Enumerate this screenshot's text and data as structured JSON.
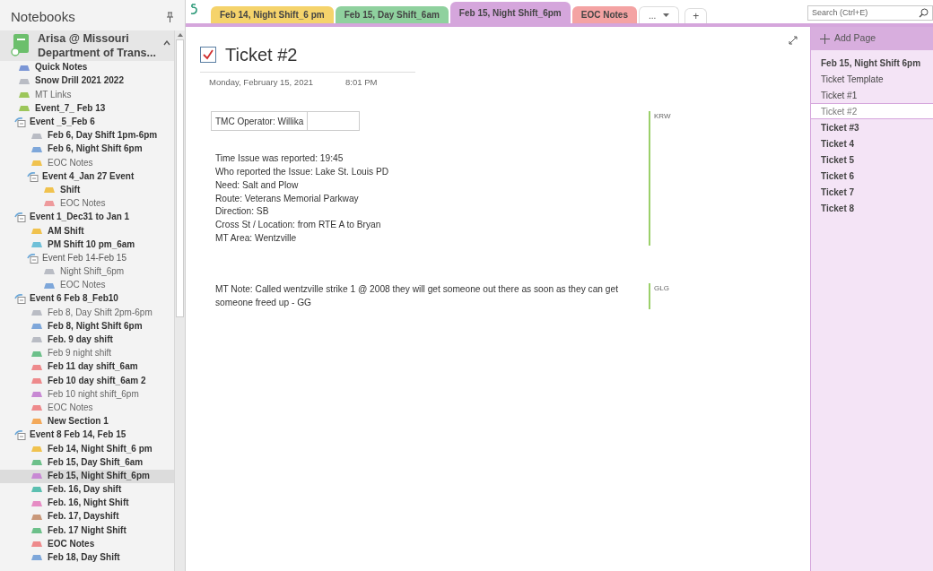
{
  "sidebar": {
    "title": "Notebooks",
    "notebook": {
      "name_line_1": "Arisa @ Missouri",
      "name_line_2": "Department of Trans...",
      "expanded": true
    },
    "items": [
      {
        "kind": "section",
        "label": "Quick Notes",
        "color": "#7b96d6",
        "unread": true,
        "selected": false
      },
      {
        "kind": "section",
        "label": "Snow Drill 2021 2022",
        "color": "#b9bcc4",
        "unread": true,
        "selected": false
      },
      {
        "kind": "section",
        "label": "MT Links",
        "color": "#9cc65a",
        "unread": false,
        "selected": false
      },
      {
        "kind": "section",
        "label": "Event_7_ Feb 13",
        "color": "#9cc65a",
        "unread": true,
        "selected": false
      },
      {
        "kind": "group",
        "label": "Event _5_Feb 6",
        "unread": true,
        "children": [
          {
            "kind": "section",
            "label": "Feb 6, Day Shift 1pm-6pm",
            "color": "#b9bcc4",
            "unread": true,
            "selected": false
          },
          {
            "kind": "section",
            "label": "Feb 6, Night Shift 6pm",
            "color": "#7ea7da",
            "unread": true,
            "selected": false
          },
          {
            "kind": "section",
            "label": "EOC Notes",
            "color": "#f0c24e",
            "unread": false,
            "selected": false
          },
          {
            "kind": "group",
            "label": "Event 4_Jan 27 Event",
            "unread": true,
            "children": [
              {
                "kind": "section",
                "label": "Shift",
                "color": "#f0c24e",
                "unread": true,
                "selected": false
              },
              {
                "kind": "section",
                "label": "EOC Notes",
                "color": "#ee9a9c",
                "unread": false,
                "selected": false
              }
            ]
          }
        ]
      },
      {
        "kind": "group",
        "label": "Event 1_Dec31 to Jan 1",
        "unread": true,
        "children": [
          {
            "kind": "section",
            "label": "AM Shift",
            "color": "#f0c24e",
            "unread": true,
            "selected": false
          },
          {
            "kind": "section",
            "label": "PM Shift 10 pm_6am",
            "color": "#6fc0d8",
            "unread": true,
            "selected": false
          },
          {
            "kind": "group",
            "label": "Event Feb 14-Feb 15",
            "unread": false,
            "children": [
              {
                "kind": "section",
                "label": "Night Shift_6pm",
                "color": "#b9bcc4",
                "unread": false,
                "selected": false
              },
              {
                "kind": "section",
                "label": "EOC Notes",
                "color": "#7ea7da",
                "unread": false,
                "selected": false
              }
            ]
          }
        ]
      },
      {
        "kind": "group",
        "label": "Event 6 Feb 8_Feb10",
        "unread": true,
        "children": [
          {
            "kind": "section",
            "label": "Feb 8, Day Shift 2pm-6pm",
            "color": "#b9bcc4",
            "unread": false,
            "selected": false
          },
          {
            "kind": "section",
            "label": "Feb 8, Night Shift 6pm",
            "color": "#7ea7da",
            "unread": true,
            "selected": false
          },
          {
            "kind": "section",
            "label": "Feb. 9 day shift",
            "color": "#b9bcc4",
            "unread": true,
            "selected": false
          },
          {
            "kind": "section",
            "label": "Feb 9 night shift",
            "color": "#6cc08a",
            "unread": false,
            "selected": false
          },
          {
            "kind": "section",
            "label": "Feb 11 day shift_6am",
            "color": "#ee8a8c",
            "unread": true,
            "selected": false
          },
          {
            "kind": "section",
            "label": "Feb 10 day shift_6am 2",
            "color": "#ee8a8c",
            "unread": true,
            "selected": false
          },
          {
            "kind": "section",
            "label": "Feb 10 night shift_6pm",
            "color": "#c889d4",
            "unread": false,
            "selected": false
          },
          {
            "kind": "section",
            "label": "EOC Notes",
            "color": "#ee8a8c",
            "unread": false,
            "selected": false
          },
          {
            "kind": "section",
            "label": "New Section 1",
            "color": "#f3a95a",
            "unread": true,
            "selected": false
          }
        ]
      },
      {
        "kind": "group",
        "label": "Event 8 Feb 14, Feb 15",
        "unread": true,
        "children": [
          {
            "kind": "section",
            "label": "Feb 14, Night Shift_6 pm",
            "color": "#f0c24e",
            "unread": true,
            "selected": false
          },
          {
            "kind": "section",
            "label": "Feb 15, Day Shift_6am",
            "color": "#6cc08a",
            "unread": true,
            "selected": false
          },
          {
            "kind": "section",
            "label": "Feb 15, Night Shift_6pm",
            "color": "#c889d4",
            "unread": true,
            "selected": true
          },
          {
            "kind": "section",
            "label": "Feb. 16, Day shift",
            "color": "#5bbfb0",
            "unread": true,
            "selected": false
          },
          {
            "kind": "section",
            "label": "Feb. 16, Night Shift",
            "color": "#e68cc4",
            "unread": true,
            "selected": false
          },
          {
            "kind": "section",
            "label": "Feb. 17, Dayshift",
            "color": "#c9987a",
            "unread": true,
            "selected": false
          },
          {
            "kind": "section",
            "label": "Feb. 17 Night Shift",
            "color": "#6cc08a",
            "unread": true,
            "selected": false
          },
          {
            "kind": "section",
            "label": "EOC Notes",
            "color": "#ee8a8c",
            "unread": true,
            "selected": false
          },
          {
            "kind": "section",
            "label": "Feb 18, Day Shift",
            "color": "#7ea7da",
            "unread": true,
            "selected": false
          }
        ]
      }
    ]
  },
  "tabs": [
    {
      "label": "Feb 14, Night Shift_6 pm",
      "color": "#f5d36b",
      "selected": false
    },
    {
      "label": "Feb 15, Day Shift_6am",
      "color": "#8fd19e",
      "selected": false
    },
    {
      "label": "Feb 15, Night Shift_6pm",
      "color": "#d5a6dc",
      "selected": true
    },
    {
      "label": "EOC Notes",
      "color": "#f4a3a3",
      "selected": false
    }
  ],
  "tab_overflow": "...",
  "add_tab": "+",
  "search": {
    "placeholder": "Search (Ctrl+E)"
  },
  "page": {
    "title": "Ticket #2",
    "done": true,
    "date": "Monday, February 15, 2021",
    "time": "8:01 PM",
    "operator_cell": "TMC Operator: Willika",
    "blocks": [
      {
        "author": "KRW",
        "lines": [
          "Time Issue was reported: 19:45",
          "Who reported the Issue: Lake St. Louis PD",
          "Need: Salt and Plow",
          "Route: Veterans Memorial Parkway",
          "Direction: SB",
          "Cross St / Location: from RTE A to Bryan",
          "MT Area: Wentzville"
        ]
      },
      {
        "author": "GLG",
        "lines": [
          "MT Note: Called wentzville strike 1 @ 2008 they will get someone out there as soon as they can get someone freed up - GG"
        ]
      }
    ]
  },
  "pages": {
    "add_label": "Add Page",
    "items": [
      {
        "label": "Feb 15, Night Shift 6pm",
        "unread": true,
        "selected": false
      },
      {
        "label": "Ticket Template",
        "unread": false,
        "selected": false
      },
      {
        "label": "Ticket #1",
        "unread": false,
        "selected": false
      },
      {
        "label": "Ticket #2",
        "unread": false,
        "selected": true
      },
      {
        "label": "Ticket #3",
        "unread": true,
        "selected": false
      },
      {
        "label": "Ticket 4",
        "unread": true,
        "selected": false
      },
      {
        "label": "Ticket 5",
        "unread": true,
        "selected": false
      },
      {
        "label": "Ticket 6",
        "unread": true,
        "selected": false
      },
      {
        "label": "Ticket 7",
        "unread": true,
        "selected": false
      },
      {
        "label": "Ticket 8",
        "unread": true,
        "selected": false
      }
    ]
  }
}
